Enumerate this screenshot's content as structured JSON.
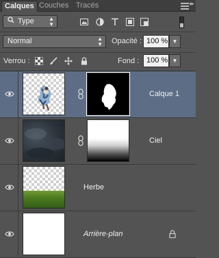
{
  "tabs": [
    {
      "label": "Calques",
      "active": true
    },
    {
      "label": "Couches",
      "active": false
    },
    {
      "label": "Tracés",
      "active": false
    }
  ],
  "filter": {
    "selected": "Type",
    "icons": [
      "image-filter-icon",
      "adjustment-filter-icon",
      "text-filter-icon",
      "shape-filter-icon",
      "smart-object-filter-icon"
    ]
  },
  "blend": {
    "mode": "Normal",
    "opacity_label": "Opacité :",
    "opacity_value": "100 %"
  },
  "lock": {
    "label": "Verrou :",
    "fill_label": "Fond :",
    "fill_value": "100 %"
  },
  "layers": [
    {
      "name": "Calque 1",
      "visible": true,
      "selected": true,
      "has_mask": true
    },
    {
      "name": "Ciel",
      "visible": true,
      "selected": false,
      "has_mask": true
    },
    {
      "name": "Herbe",
      "visible": true,
      "selected": false,
      "has_mask": false
    },
    {
      "name": "Arrière-plan",
      "visible": true,
      "selected": false,
      "locked": true
    }
  ],
  "colors": {
    "panel": "#535353",
    "selected_row": "#5d6d85",
    "tab_bar": "#3e3e3e"
  }
}
